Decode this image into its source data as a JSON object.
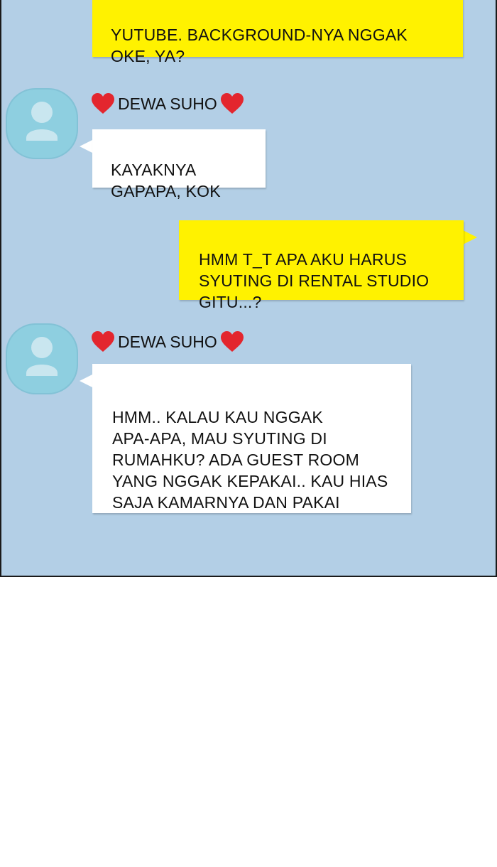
{
  "colors": {
    "panel_bg": "#b3cfe6",
    "my_bubble": "#fff200",
    "their_bubble": "#ffffff",
    "avatar": "#8ecfe0",
    "heart": "#e3262e"
  },
  "messages": [
    {
      "from": "me",
      "text": "YUTUBE. BACKGROUND-NYA NGGAK\nOKE, YA?"
    },
    {
      "from": "them",
      "sender": "DEWA SUHO",
      "text": "KAYAKNYA\nGAPAPA, KOK"
    },
    {
      "from": "me",
      "text": "HMM T_T APA AKU HARUS\nSYUTING DI RENTAL STUDIO\nGITU...?"
    },
    {
      "from": "them",
      "sender": "DEWA SUHO",
      "text": "HMM.. KALAU KAU NGGAK\nAPA-APA, MAU SYUTING DI\nRUMAHKU? ADA GUEST ROOM\nYANG NGGAK KEPAKAI.. KAU HIAS\nSAJA KAMARNYA DAN PAKAI"
    }
  ]
}
